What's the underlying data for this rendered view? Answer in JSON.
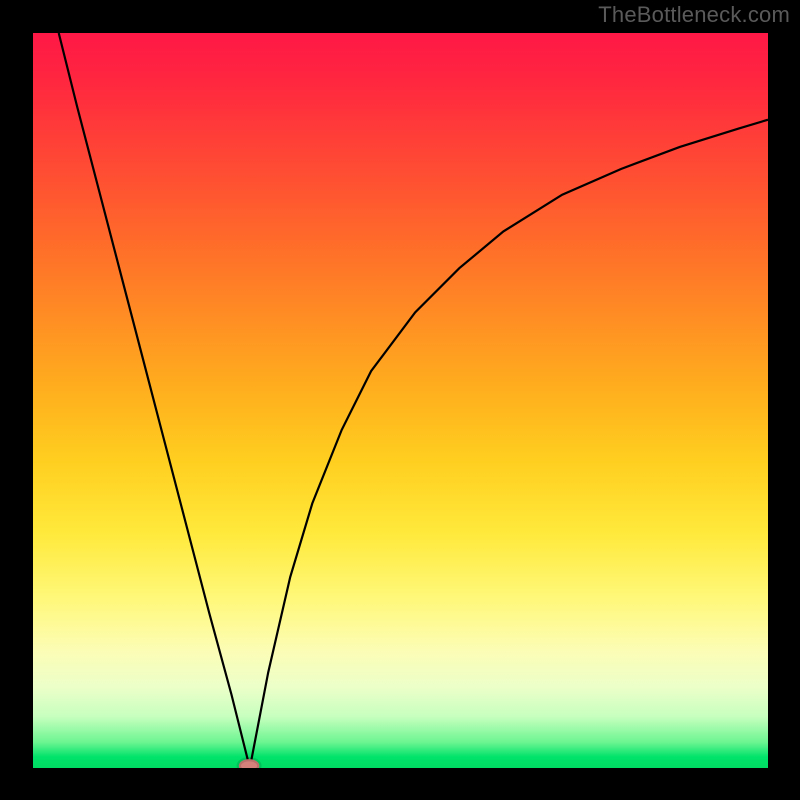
{
  "watermark": "TheBottleneck.com",
  "chart_data": {
    "type": "line",
    "title": "",
    "xlabel": "",
    "ylabel": "",
    "xlim": [
      0,
      100
    ],
    "ylim": [
      0,
      100
    ],
    "grid": false,
    "legend": false,
    "colors": {
      "gradient_top": "#ff1846",
      "gradient_bottom": "#00db63",
      "curve": "#000000",
      "marker": "#d4817c"
    },
    "series": [
      {
        "name": "left-branch",
        "x": [
          3.5,
          6,
          9,
          12,
          15,
          18,
          21,
          24,
          27,
          29.5
        ],
        "values": [
          100,
          90,
          78.5,
          67,
          55.5,
          44,
          32.5,
          21,
          10,
          0
        ]
      },
      {
        "name": "right-branch",
        "x": [
          29.5,
          32,
          35,
          38,
          42,
          46,
          52,
          58,
          64,
          72,
          80,
          88,
          96,
          100
        ],
        "values": [
          0,
          13,
          26,
          36,
          46,
          54,
          62,
          68,
          73,
          78,
          81.5,
          84.5,
          87,
          88.2
        ]
      }
    ],
    "marker": {
      "x": 29.4,
      "y": 0.3,
      "rx": 1.4,
      "ry": 0.9
    }
  }
}
